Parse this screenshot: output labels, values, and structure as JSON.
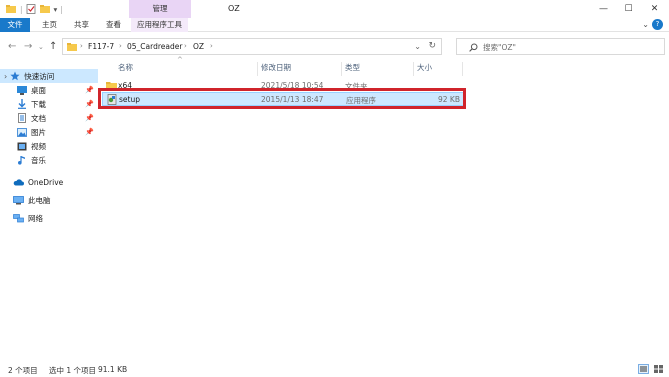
{
  "window": {
    "title": "OZ",
    "context_group": "管理",
    "minimize_glyph": "—",
    "maximize_glyph": "☐",
    "close_glyph": "✕"
  },
  "quick_access_toolbar": {
    "separator": "|",
    "dropdown_glyph": "▾"
  },
  "ribbon": {
    "tabs": [
      "文件",
      "主页",
      "共享",
      "查看",
      "应用程序工具"
    ],
    "collapse_glyph": "⌄",
    "help_glyph": "?",
    "accent_color": "#1979ca",
    "context_color": "#e9d5f5"
  },
  "navigation": {
    "back_glyph": "←",
    "forward_glyph": "→",
    "recent_glyph": "⌄",
    "up_glyph": "↑",
    "refresh_glyph": "↻",
    "breadcrumb_sep": "›",
    "breadcrumb_dropdown_glyph": "⌄",
    "breadcrumb": [
      "F117-7",
      "05_Cardreader",
      "OZ"
    ]
  },
  "search": {
    "placeholder": "搜索\"OZ\"",
    "icon": "search-icon"
  },
  "sidebar": {
    "pin_glyph": "📌",
    "items": [
      {
        "label": "快速访问",
        "icon": "star-icon"
      },
      {
        "label": "桌面",
        "icon": "desktop-icon"
      },
      {
        "label": "下载",
        "icon": "download-icon"
      },
      {
        "label": "文档",
        "icon": "document-icon"
      },
      {
        "label": "图片",
        "icon": "pictures-icon"
      },
      {
        "label": "视频",
        "icon": "video-icon"
      },
      {
        "label": "音乐",
        "icon": "music-icon"
      },
      {
        "label": "OneDrive",
        "icon": "cloud-icon"
      },
      {
        "label": "此电脑",
        "icon": "computer-icon"
      },
      {
        "label": "网络",
        "icon": "network-icon"
      }
    ]
  },
  "file_list": {
    "sort_glyph": "^",
    "columns": [
      "名称",
      "修改日期",
      "类型",
      "大小"
    ],
    "rows": [
      {
        "name": "x64",
        "modified": "2021/5/18 10:54",
        "type": "文件夹",
        "size": "",
        "icon": "folder-icon"
      },
      {
        "name": "setup",
        "modified": "2015/1/13 18:47",
        "type": "应用程序",
        "size": "92 KB",
        "icon": "setup-app-icon",
        "selected": true
      }
    ],
    "highlight_color": "#d0242b"
  },
  "status_bar": {
    "item_count": "2 个项目",
    "selection": "选中 1 个项目",
    "selection_size": "91.1 KB"
  }
}
